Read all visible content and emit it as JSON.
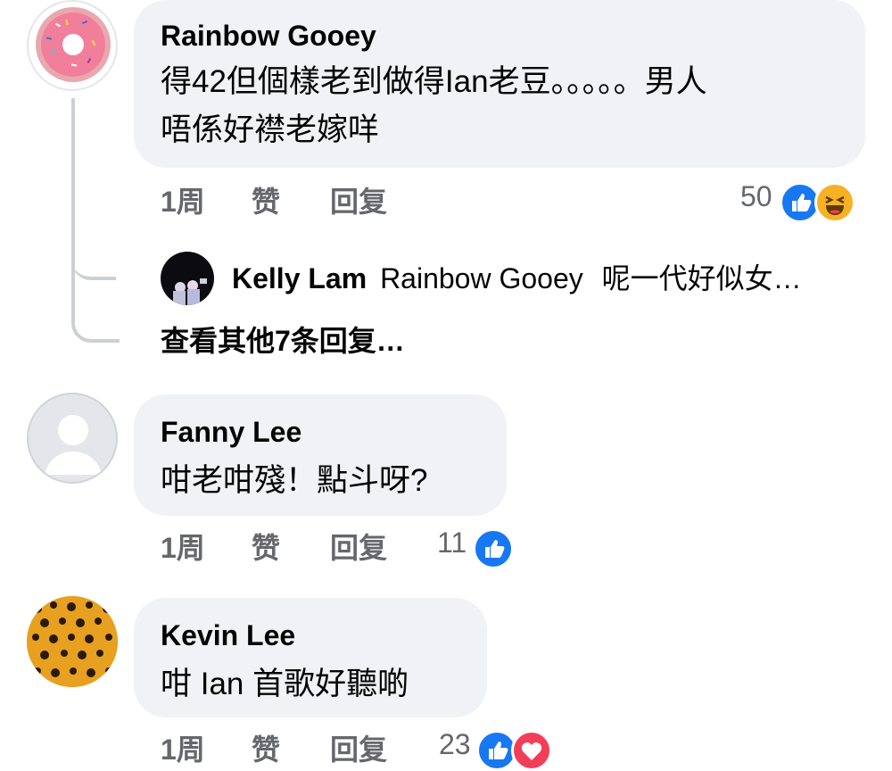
{
  "comments": [
    {
      "author": "Rainbow Gooey",
      "text_line1": "得42但個樣老到做得Ian老豆。。。。。男人",
      "text_line2": "唔係好襟老嫁咩",
      "time": "1周",
      "like_label": "赞",
      "reply_label": "回复",
      "reaction_count": "50",
      "reactions": [
        "like",
        "haha"
      ],
      "replies": [
        {
          "author": "Kelly Lam",
          "mention": "Rainbow Gooey",
          "text": "呢一代好似女…"
        }
      ],
      "more_replies_label": "查看其他7条回复…"
    },
    {
      "author": "Fanny Lee",
      "text": "咁老咁殘！點斗呀?",
      "time": "1周",
      "like_label": "赞",
      "reply_label": "回复",
      "reaction_count": "11",
      "reactions": [
        "like"
      ]
    },
    {
      "author": "Kevin Lee",
      "text": "咁 Ian 首歌好聽啲",
      "time": "1周",
      "like_label": "赞",
      "reply_label": "回复",
      "reaction_count": "23",
      "reactions": [
        "like",
        "love"
      ]
    }
  ],
  "colors": {
    "bubble": "#f0f2f5",
    "meta": "#65676b",
    "like": "#1877f2",
    "love": "#f33e58",
    "haha": "#f7b125"
  }
}
